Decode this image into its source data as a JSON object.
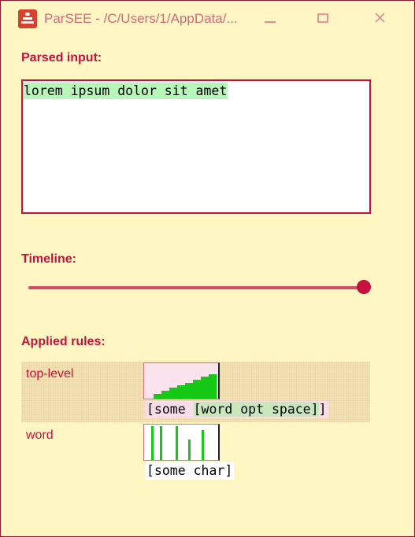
{
  "window": {
    "title": "ParSEE - /C/Users/1/AppData/...",
    "accent": "#c8103f",
    "background": "#fff6c4",
    "icons": {
      "minimize": "minimize-icon",
      "maximize": "maximize-icon",
      "close": "close-icon",
      "app": "parsee-app-icon"
    }
  },
  "parsed_input": {
    "label": "Parsed input:",
    "value": "lorem ipsum dolor sit amet",
    "highlight_color": "#b8f5b8"
  },
  "timeline": {
    "label": "Timeline:",
    "value": 1.0
  },
  "rules": {
    "label": "Applied rules:",
    "items": [
      {
        "name": "top-level",
        "expression": "[some [word opt space]]",
        "expression_parts": {
          "open": "[some ",
          "inner": "[word opt space]",
          "close": "]"
        },
        "histogram": {
          "type": "staircase",
          "levels": [
            0.12,
            0.12,
            0.25,
            0.25,
            0.38,
            0.38,
            0.5,
            0.5,
            0.62,
            0.62,
            0.75,
            0.75,
            0.88,
            0.88,
            1.0,
            1.0
          ]
        }
      },
      {
        "name": "word",
        "expression": "[some char]",
        "histogram": {
          "type": "bars",
          "levels": [
            1.0,
            1.0,
            1.0,
            0.75,
            0.5,
            0.88
          ]
        }
      }
    ]
  }
}
